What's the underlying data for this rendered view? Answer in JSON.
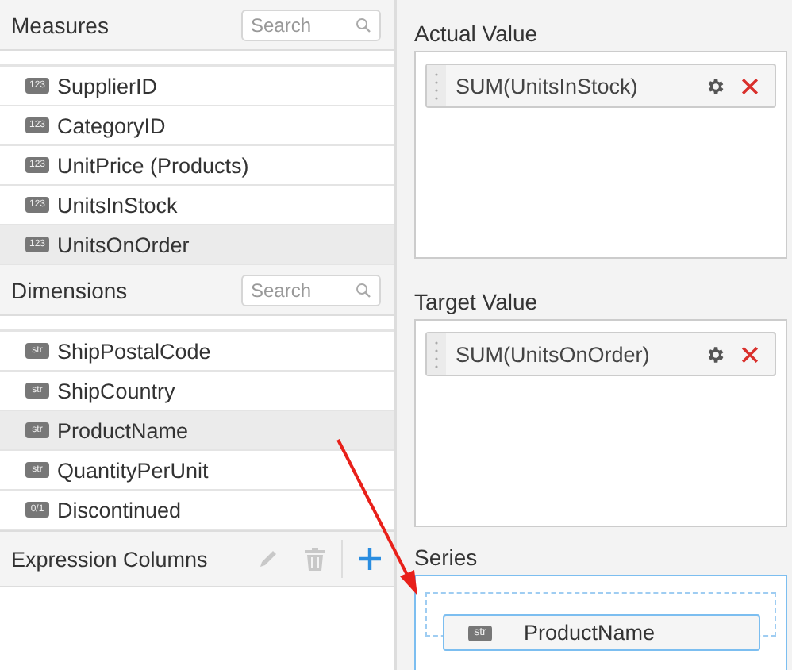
{
  "sections": [
    {
      "title": "Measures",
      "search": {
        "placeholder": "Search"
      },
      "items": [
        {
          "label": "SupplierID",
          "badge": "123",
          "hovered": false
        },
        {
          "label": "CategoryID",
          "badge": "123",
          "hovered": false
        },
        {
          "label": "UnitPrice (Products)",
          "badge": "123",
          "hovered": false
        },
        {
          "label": "UnitsInStock",
          "badge": "123",
          "hovered": false
        },
        {
          "label": "UnitsOnOrder",
          "badge": "123",
          "hovered": true
        }
      ]
    },
    {
      "title": "Dimensions",
      "search": {
        "placeholder": "Search"
      },
      "items": [
        {
          "label": "ShipPostalCode",
          "badge": "str",
          "hovered": false
        },
        {
          "label": "ShipCountry",
          "badge": "str",
          "hovered": false
        },
        {
          "label": "ProductName",
          "badge": "str",
          "hovered": true
        },
        {
          "label": "QuantityPerUnit",
          "badge": "str",
          "hovered": false
        },
        {
          "label": "Discontinued",
          "badge": "0/1",
          "hovered": false
        }
      ]
    }
  ],
  "expression_columns": {
    "title": "Expression Columns",
    "edit_disabled": true,
    "delete_disabled": true
  },
  "wells": [
    {
      "title": "Actual Value",
      "kind": "value",
      "active": false,
      "items": [
        {
          "label": "SUM(UnitsInStock)"
        }
      ]
    },
    {
      "title": "Target Value",
      "kind": "value",
      "active": false,
      "items": [
        {
          "label": "SUM(UnitsOnOrder)"
        }
      ]
    },
    {
      "title": "Series",
      "kind": "drop",
      "active": true,
      "dragged": {
        "label": "ProductName",
        "badge": "str"
      }
    }
  ]
}
